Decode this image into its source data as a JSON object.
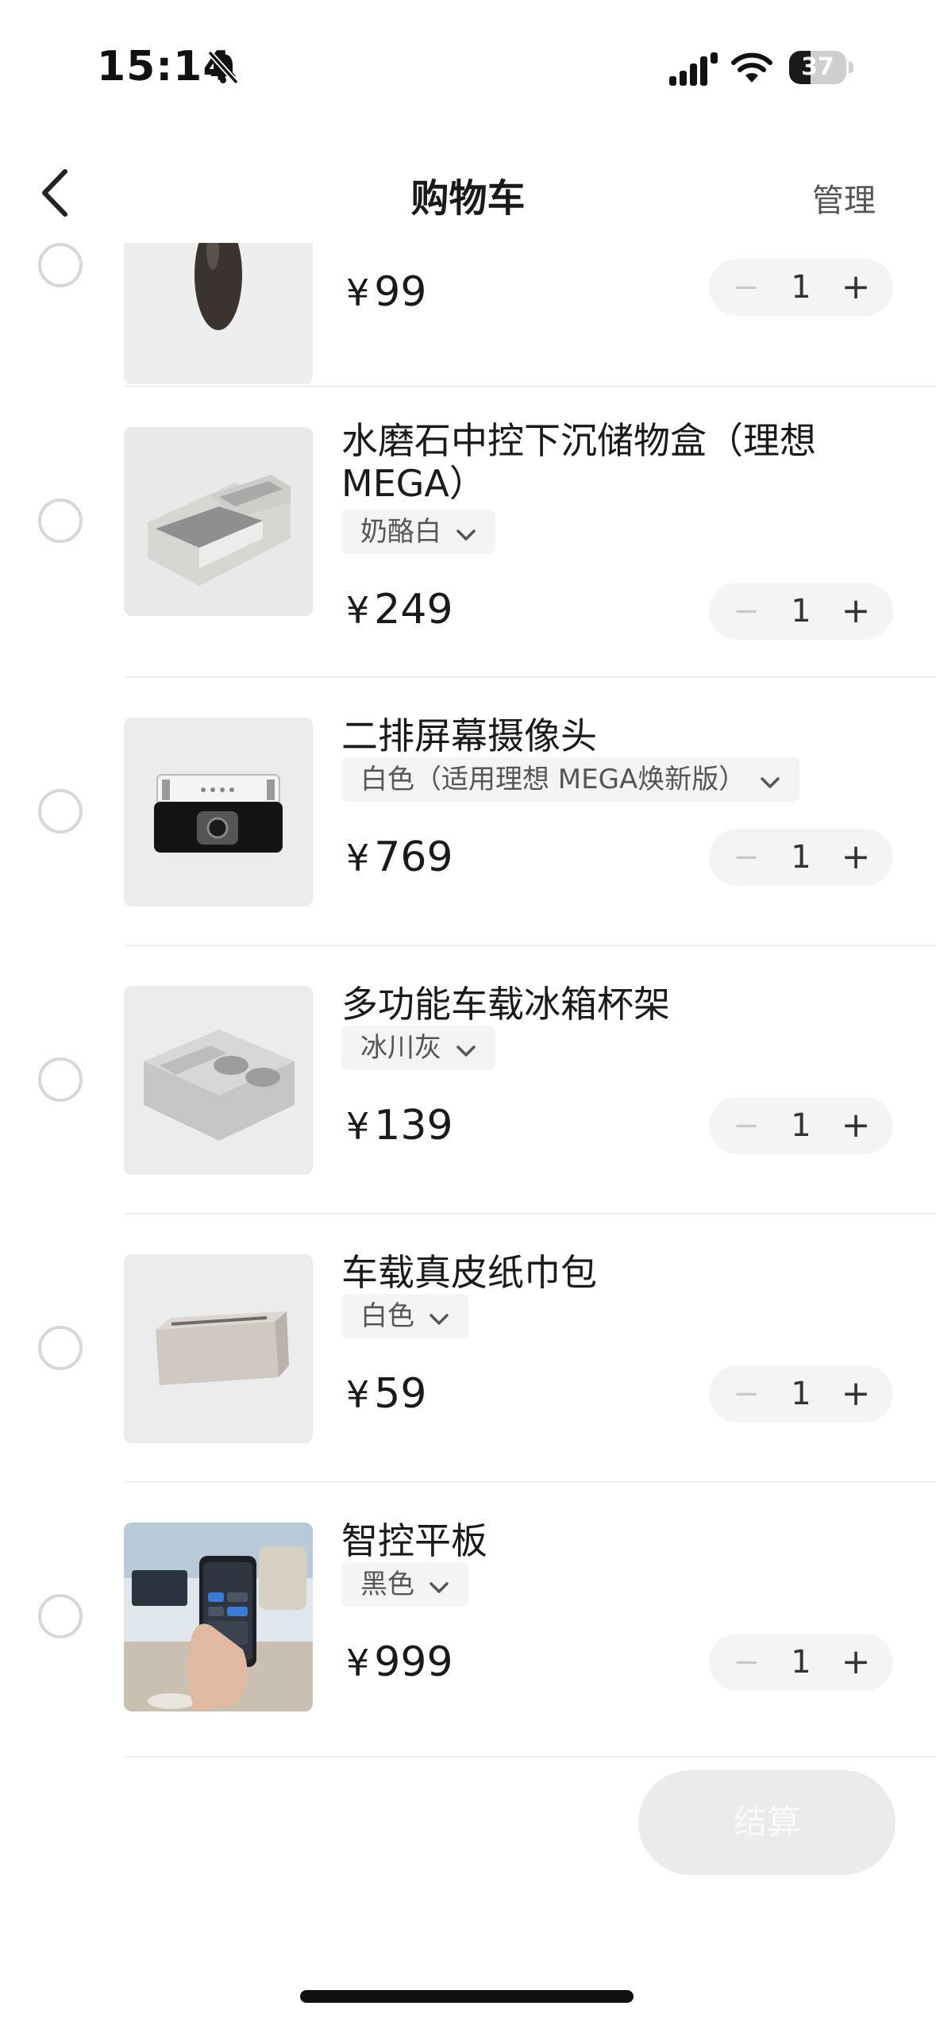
{
  "status_bar": {
    "time": "15:14",
    "battery": "37",
    "battery_level": 0.37
  },
  "nav": {
    "title": "购物车",
    "manage": "管理"
  },
  "items": [
    {
      "name": "",
      "spec": "",
      "currency": "¥",
      "price": "99",
      "qty": "1",
      "minus": "−",
      "plus": "+"
    },
    {
      "name": "水磨石中控下沉储物盒（理想MEGA）",
      "spec": "奶酪白",
      "currency": "¥",
      "price": "249",
      "qty": "1",
      "minus": "−",
      "plus": "+"
    },
    {
      "name": "二排屏幕摄像头",
      "spec": "白色（适用理想 MEGA焕新版）",
      "currency": "¥",
      "price": "769",
      "qty": "1",
      "minus": "−",
      "plus": "+"
    },
    {
      "name": "多功能车载冰箱杯架",
      "spec": "冰川灰",
      "currency": "¥",
      "price": "139",
      "qty": "1",
      "minus": "−",
      "plus": "+"
    },
    {
      "name": "车载真皮纸巾包",
      "spec": "白色",
      "currency": "¥",
      "price": "59",
      "qty": "1",
      "minus": "−",
      "plus": "+"
    },
    {
      "name": "智控平板",
      "spec": "黑色",
      "currency": "¥",
      "price": "999",
      "qty": "1",
      "minus": "−",
      "plus": "+"
    }
  ],
  "checkout": {
    "label": "结算"
  },
  "colors": {
    "accent": "#ebebeb",
    "text": "#1a1a1a"
  }
}
